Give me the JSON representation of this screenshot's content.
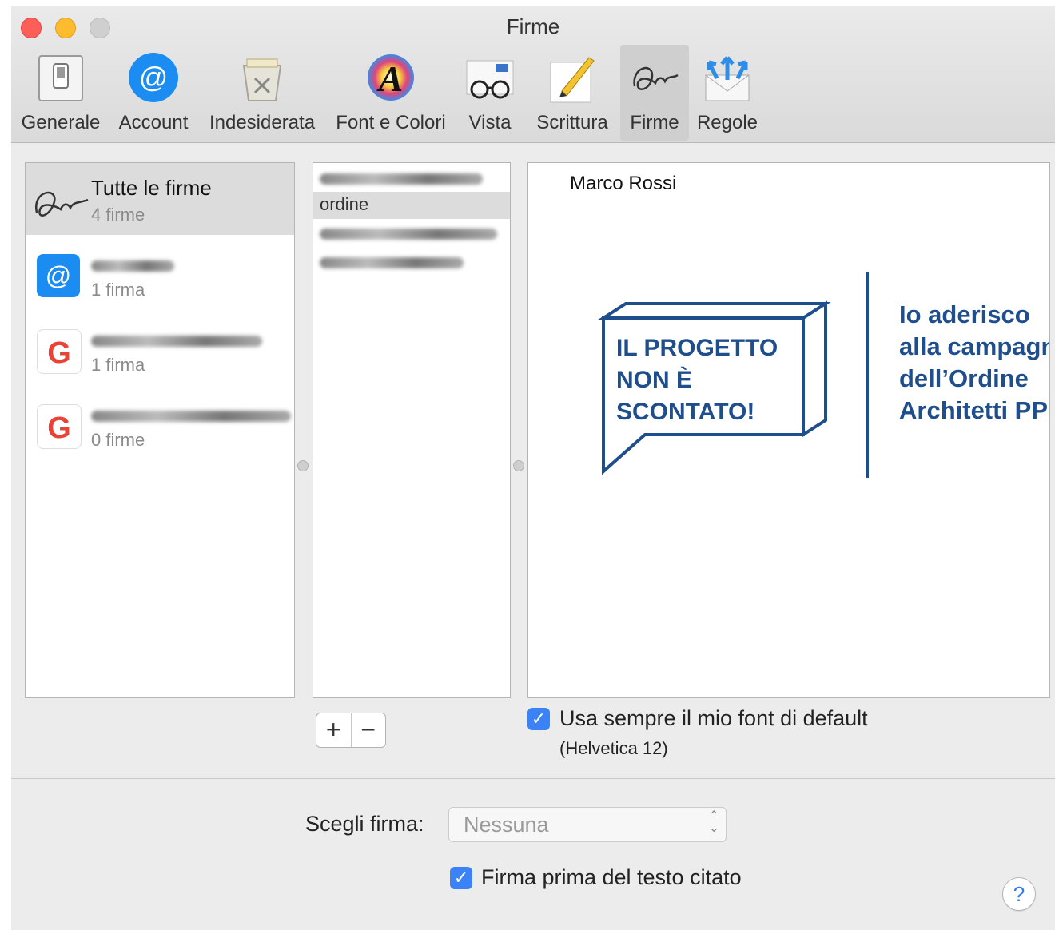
{
  "window": {
    "title": "Firme"
  },
  "toolbar": {
    "items": [
      {
        "label": "Generale",
        "icon": "switch-icon"
      },
      {
        "label": "Account",
        "icon": "at-icon"
      },
      {
        "label": "Indesiderata",
        "icon": "junk-icon"
      },
      {
        "label": "Font e Colori",
        "icon": "font-colors-icon"
      },
      {
        "label": "Vista",
        "icon": "glasses-icon"
      },
      {
        "label": "Scrittura",
        "icon": "pencil-icon"
      },
      {
        "label": "Firme",
        "icon": "signature-icon",
        "active": true
      },
      {
        "label": "Regole",
        "icon": "rules-icon"
      }
    ]
  },
  "accounts": [
    {
      "name": "Tutte le firme",
      "count": "4 firme",
      "icon": "signature-icon",
      "selected": true
    },
    {
      "name": "",
      "count": "1 firma",
      "icon": "at-icon"
    },
    {
      "name": "",
      "count": "1 firma",
      "icon": "google-icon"
    },
    {
      "name": "",
      "count": "0 firme",
      "icon": "google-icon"
    }
  ],
  "signatures": [
    {
      "label": ""
    },
    {
      "label": "ordine",
      "selected": true
    },
    {
      "label": ""
    },
    {
      "label": ""
    }
  ],
  "preview": {
    "name": "Marco Rossi",
    "box_lines": [
      "IL PROGETTO",
      "NON È",
      "SCONTATO!"
    ],
    "side_lines": [
      "Io aderisco",
      "alla campagna",
      "dell’Ordine",
      "Architetti PP"
    ]
  },
  "options": {
    "default_font_label": "Usa sempre il mio font di default",
    "default_font_note": "(Helvetica 12)",
    "choose_label": "Scegli firma:",
    "choose_value": "Nessuna",
    "above_quote_label": "Firma prima del testo citato"
  },
  "buttons": {
    "add": "+",
    "remove": "−",
    "help": "?"
  },
  "colors": {
    "accent": "#3a82f6",
    "campaign_blue": "#1f4e8c"
  }
}
